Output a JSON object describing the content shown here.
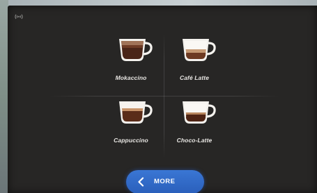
{
  "status": {
    "wifi_icon": "wifi-icon"
  },
  "drinks": [
    {
      "label": "Mokaccino",
      "icon": "mokaccino-cup-icon"
    },
    {
      "label": "Café Latte",
      "icon": "cafe-latte-cup-icon"
    },
    {
      "label": "Cappuccino",
      "icon": "cappuccino-cup-icon"
    },
    {
      "label": "Choco-Latte",
      "icon": "choco-latte-cup-icon"
    }
  ],
  "nav": {
    "more_label": "MORE",
    "more_icon": "chevron-left-icon"
  },
  "colors": {
    "screen_background": "#272625",
    "button_blue": "#2f68c8",
    "label_text": "#e8e6e3"
  }
}
